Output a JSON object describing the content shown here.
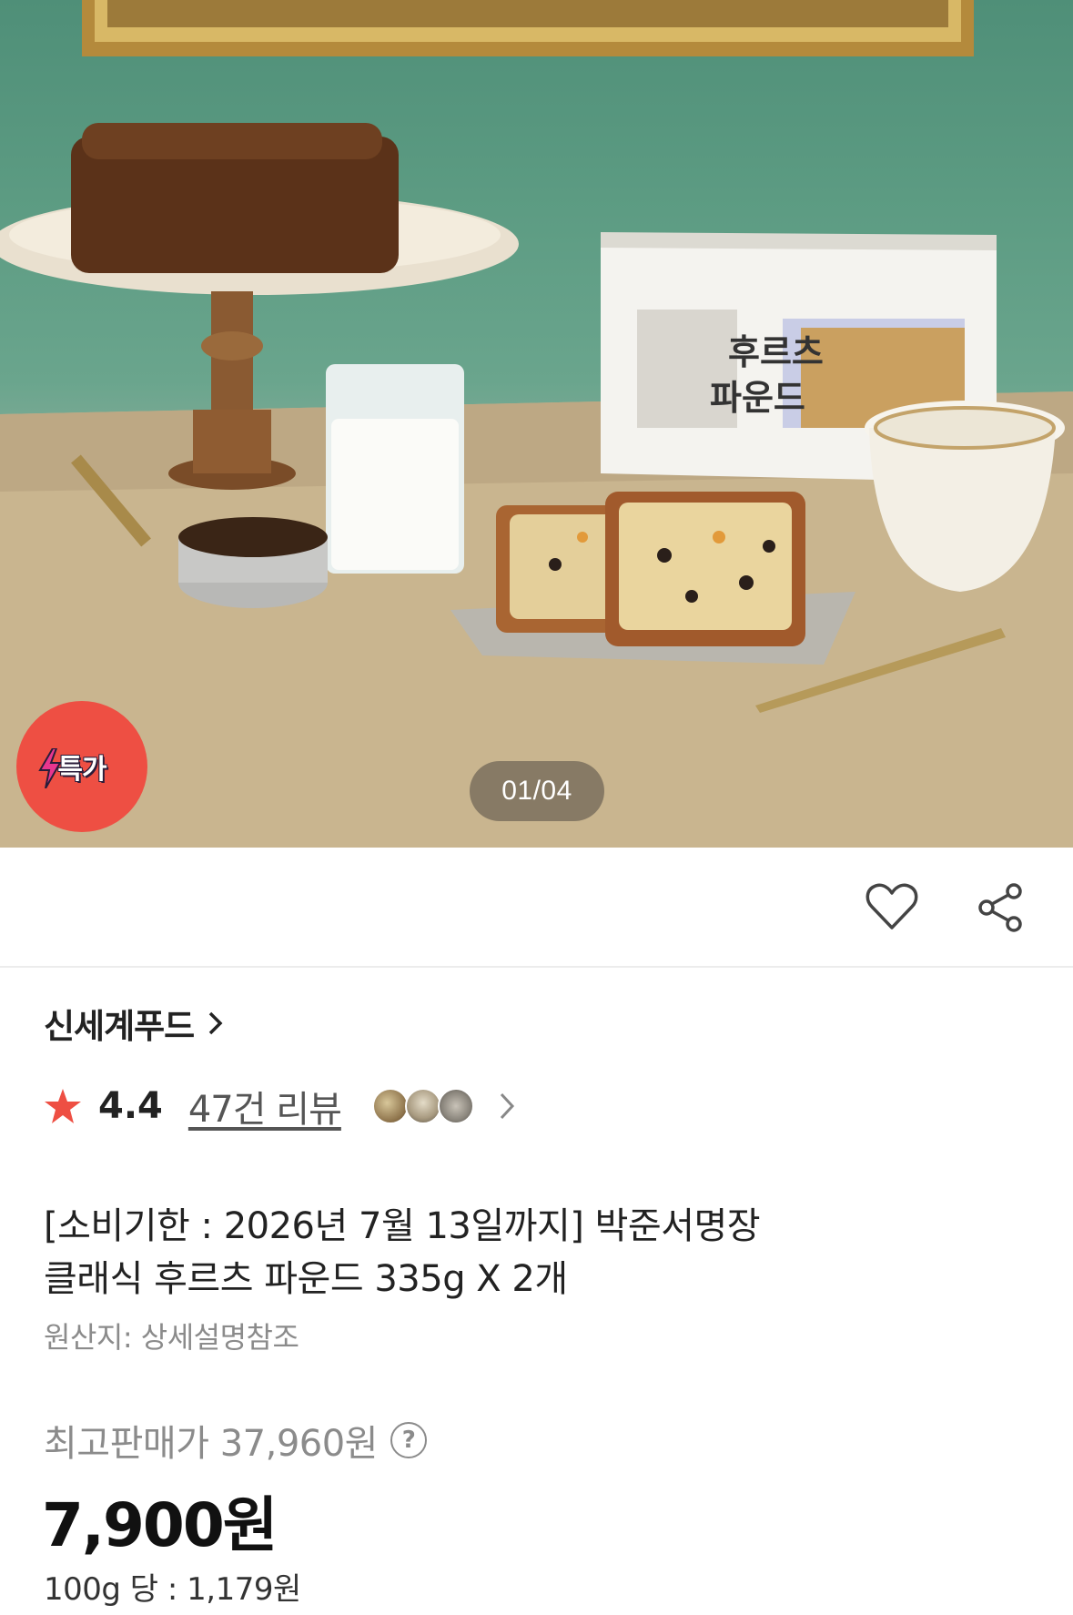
{
  "hero": {
    "image_alt": "박준서명장 후르츠 파운드 product photo",
    "deal_badge": "특가",
    "counter": "01/04"
  },
  "actions": {
    "like_icon": "heart-icon",
    "share_icon": "share-icon"
  },
  "product": {
    "brand": "신세계푸드",
    "rating": "4.4",
    "review_link": "47건 리뷰",
    "title_line1": "[소비기한 : 2026년 7월 13일까지] 박준서명장",
    "title_line2": "클래식 후르츠 파운드 335g X 2개",
    "origin": "원산지: 상세설명참조",
    "original_price_label": "최고판매가 37,960원",
    "help_icon": "?",
    "sale_price": "7,900원",
    "unit_price": "100g 당 : 1,179원"
  },
  "colors": {
    "badge": "#ee4f43",
    "star": "#ee4f43",
    "counter_bg": "#6e6455"
  }
}
